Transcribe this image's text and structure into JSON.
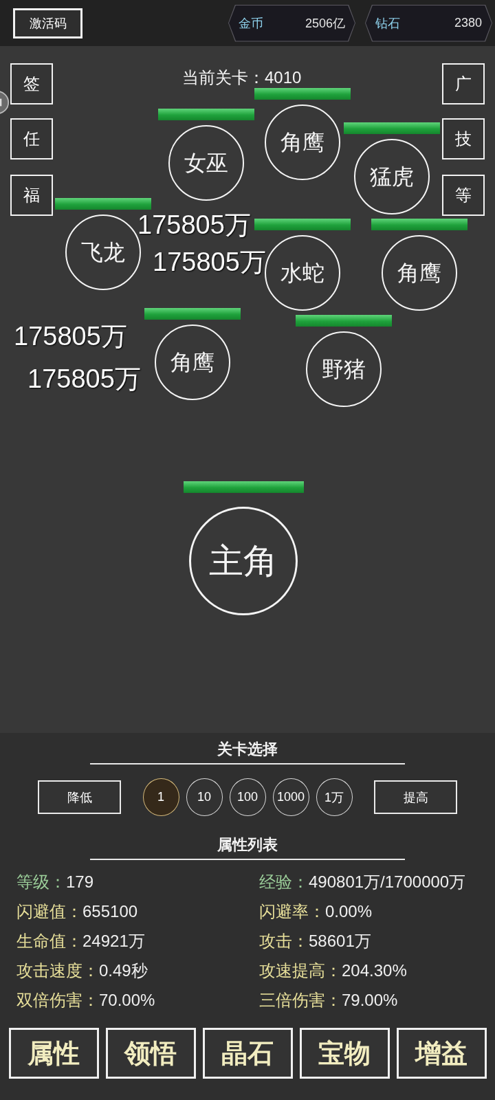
{
  "header": {
    "activate_button": "激活码",
    "currencies": [
      {
        "name": "金币",
        "amount": "2506亿"
      },
      {
        "name": "钻石",
        "amount": "2380"
      }
    ]
  },
  "battle": {
    "stage": "当前关卡：4010",
    "left_buttons": [
      "签",
      "任",
      "福"
    ],
    "right_buttons": [
      "广",
      "技",
      "等"
    ],
    "monsters": [
      {
        "name": "女巫"
      },
      {
        "name": "角鹰"
      },
      {
        "name": "猛虎"
      },
      {
        "name": "飞龙"
      },
      {
        "name": "水蛇"
      },
      {
        "name": "角鹰"
      },
      {
        "name": "角鹰"
      },
      {
        "name": "野猪"
      }
    ],
    "damage_numbers": [
      "175805万",
      "175805万",
      "175805万",
      "175805万"
    ],
    "hero": {
      "name": "主角"
    }
  },
  "stage_select": {
    "title": "关卡选择",
    "decrease": "降低",
    "increase": "提高",
    "steps": [
      {
        "label": "1",
        "selected": true
      },
      {
        "label": "10",
        "selected": false
      },
      {
        "label": "100",
        "selected": false
      },
      {
        "label": "1000",
        "selected": false
      },
      {
        "label": "1万",
        "selected": false
      }
    ]
  },
  "attributes": {
    "title": "属性列表",
    "items": [
      {
        "label": "等级：",
        "value": "179",
        "color": "#9ccf9a"
      },
      {
        "label": "经验：",
        "value": "490801万/1700000万",
        "color": "#9ccf9a"
      },
      {
        "label": "闪避值：",
        "value": "655100",
        "color": "#e8e09a"
      },
      {
        "label": "闪避率：",
        "value": "0.00%",
        "color": "#e8e09a"
      },
      {
        "label": "生命值：",
        "value": "24921万",
        "color": "#e8e09a"
      },
      {
        "label": "攻击：",
        "value": "58601万",
        "color": "#e8e09a"
      },
      {
        "label": "攻击速度：",
        "value": "0.49秒",
        "color": "#e8e09a"
      },
      {
        "label": "攻速提高：",
        "value": "204.30%",
        "color": "#e8e09a"
      },
      {
        "label": "双倍伤害：",
        "value": "70.00%",
        "color": "#e8e09a"
      },
      {
        "label": "三倍伤害：",
        "value": "79.00%",
        "color": "#e8e09a"
      }
    ]
  },
  "tabs": [
    "属性",
    "领悟",
    "晶石",
    "宝物",
    "增益"
  ]
}
